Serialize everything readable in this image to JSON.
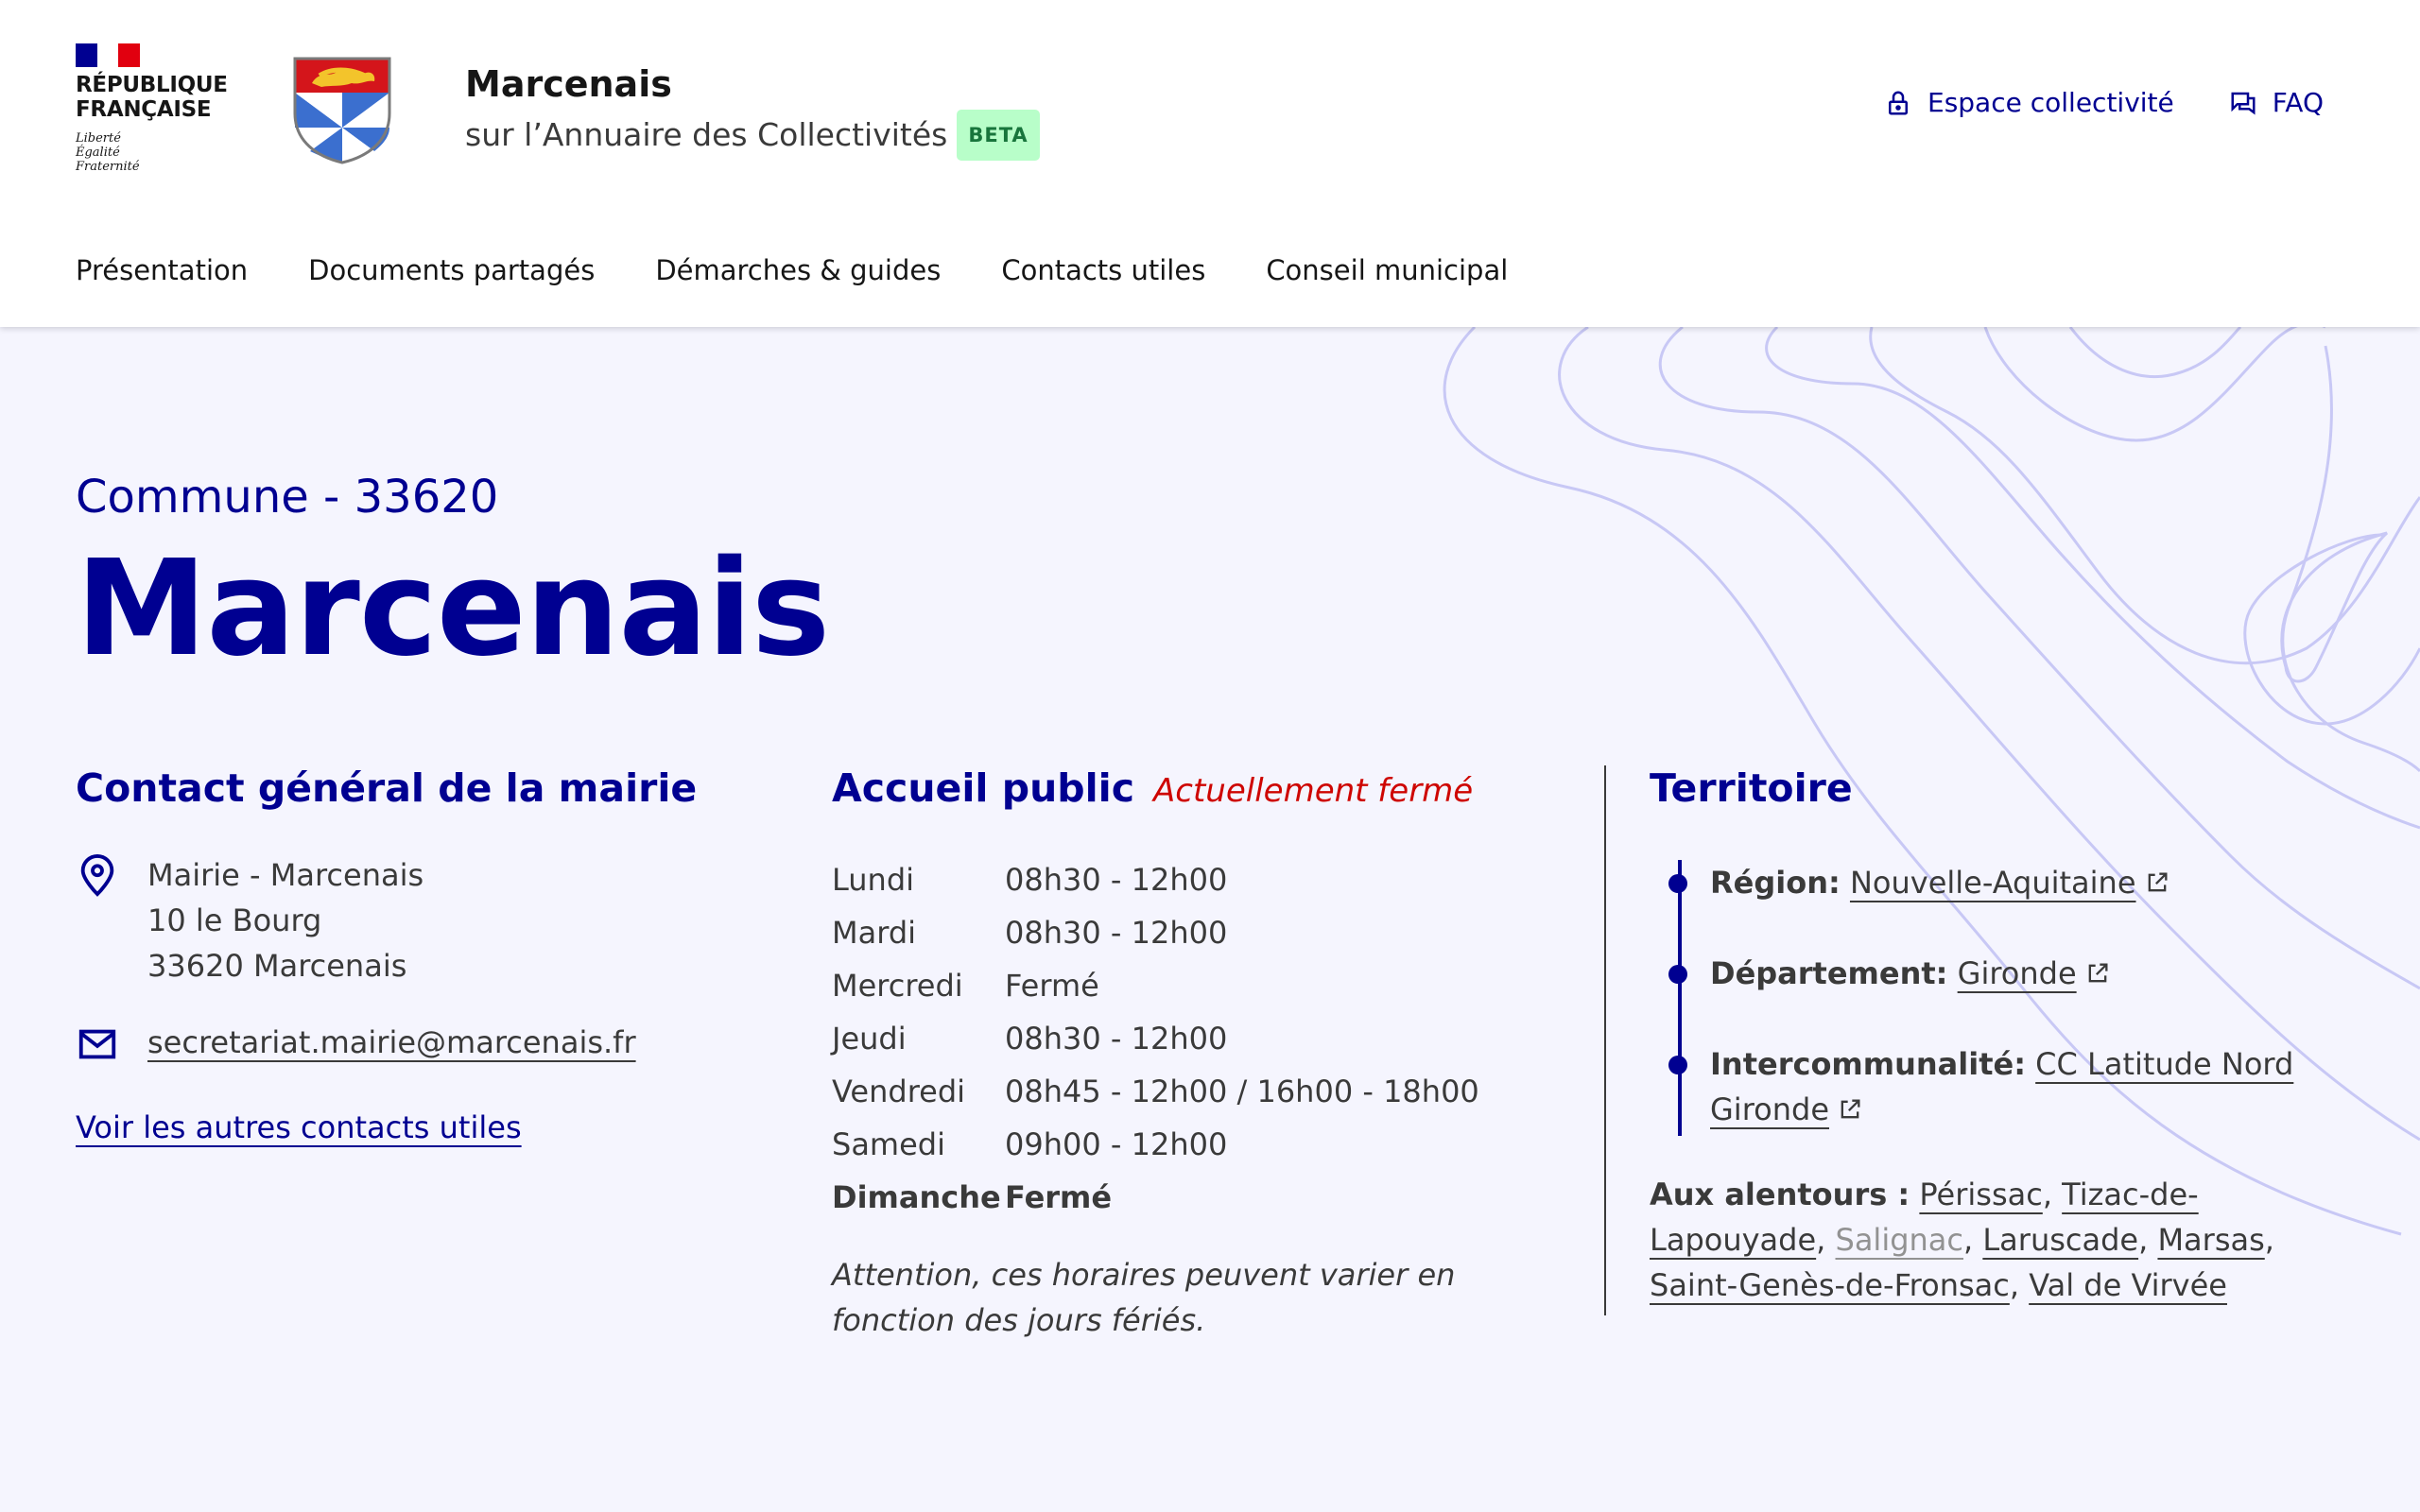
{
  "colors": {
    "primary": "#000091",
    "closed": "#ce0500",
    "beta_bg": "#b8fec9",
    "beta_text": "#18753c"
  },
  "header": {
    "rf_logo_title": "RÉPUBLIQUE\nFRANÇAISE",
    "rf_motto": "Liberté\nÉgalité\nFraternité",
    "brand_name": "Marcenais",
    "brand_sub": "sur l’Annuaire des Collectivités",
    "beta": "BETA",
    "tools": [
      {
        "label": "Espace collectivité",
        "icon": "lock-icon"
      },
      {
        "label": "FAQ",
        "icon": "chat-icon"
      }
    ]
  },
  "nav": [
    "Présentation",
    "Documents partagés",
    "Démarches & guides",
    "Contacts utiles",
    "Conseil municipal"
  ],
  "hero": {
    "kicker": "Commune - 33620",
    "title": "Marcenais"
  },
  "contact": {
    "title": "Contact général de la mairie",
    "address": [
      "Mairie - Marcenais",
      "10 le Bourg",
      "33620 Marcenais"
    ],
    "email": "secretariat.mairie@marcenais.fr",
    "more_link": "Voir les autres contacts utiles"
  },
  "accueil": {
    "title": "Accueil public",
    "status": "Actuellement fermé",
    "hours": [
      {
        "day": "Lundi",
        "value": "08h30 - 12h00"
      },
      {
        "day": "Mardi",
        "value": "08h30 - 12h00"
      },
      {
        "day": "Mercredi",
        "value": "Fermé"
      },
      {
        "day": "Jeudi",
        "value": "08h30 - 12h00"
      },
      {
        "day": "Vendredi",
        "value": "08h45 - 12h00 / 16h00 - 18h00"
      },
      {
        "day": "Samedi",
        "value": "09h00 - 12h00"
      },
      {
        "day": "Dimanche",
        "value": "Fermé"
      }
    ],
    "note": "Attention, ces horaires peuvent varier en fonction des jours fériés."
  },
  "territoire": {
    "title": "Territoire",
    "region_label": "Région:",
    "region": "Nouvelle-Aquitaine",
    "departement_label": "Département:",
    "departement": "Gironde",
    "interco_label": "Intercommunalité:",
    "interco": "CC Latitude Nord Gironde",
    "around_label": "Aux alentours :",
    "around": [
      "Périssac",
      "Tizac-de-Lapouyade",
      "Salignac",
      "Laruscade",
      "Marsas",
      "Saint-Genès-de-Fronsac",
      "Val de Virvée"
    ]
  }
}
